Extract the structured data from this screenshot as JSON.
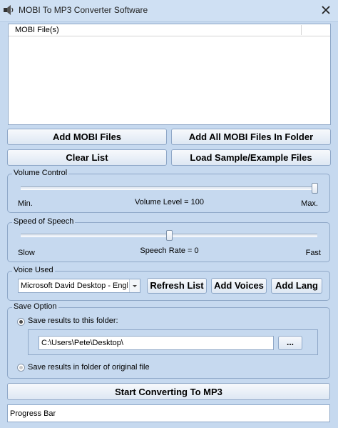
{
  "window": {
    "title": "MOBI To MP3 Converter Software",
    "app_icon": "speaker-app-icon",
    "close_icon": "close-icon"
  },
  "file_list": {
    "column_header": "MOBI File(s)",
    "items": []
  },
  "buttons": {
    "add_files": "Add MOBI Files",
    "add_folder": "Add All MOBI Files In Folder",
    "clear_list": "Clear List",
    "load_sample": "Load Sample/Example Files"
  },
  "volume": {
    "group_label": "Volume Control",
    "min_label": "Min.",
    "max_label": "Max.",
    "level_text": "Volume Level = 100",
    "level_value": 100,
    "range": [
      0,
      100
    ]
  },
  "speech": {
    "group_label": "Speed of Speech",
    "slow_label": "Slow",
    "fast_label": "Fast",
    "rate_text": "Speech Rate = 0",
    "rate_value": 0,
    "range": [
      -10,
      10
    ]
  },
  "voice": {
    "group_label": "Voice Used",
    "selected_voice": "Microsoft David Desktop - English (United States)",
    "refresh_label": "Refresh List",
    "add_voices_label": "Add Voices",
    "add_lang_label": "Add Lang"
  },
  "save": {
    "group_label": "Save Option",
    "option_folder_label": "Save results to this folder:",
    "folder_path": "C:\\Users\\Pete\\Desktop\\",
    "browse_label": "...",
    "option_original_label": "Save results in folder of original file",
    "selected_option": "folder"
  },
  "actions": {
    "start_label": "Start Converting To MP3"
  },
  "progress": {
    "label": "Progress Bar"
  },
  "colors": {
    "window_background": "#c6d9ef",
    "button_border": "#8fa8c8"
  }
}
